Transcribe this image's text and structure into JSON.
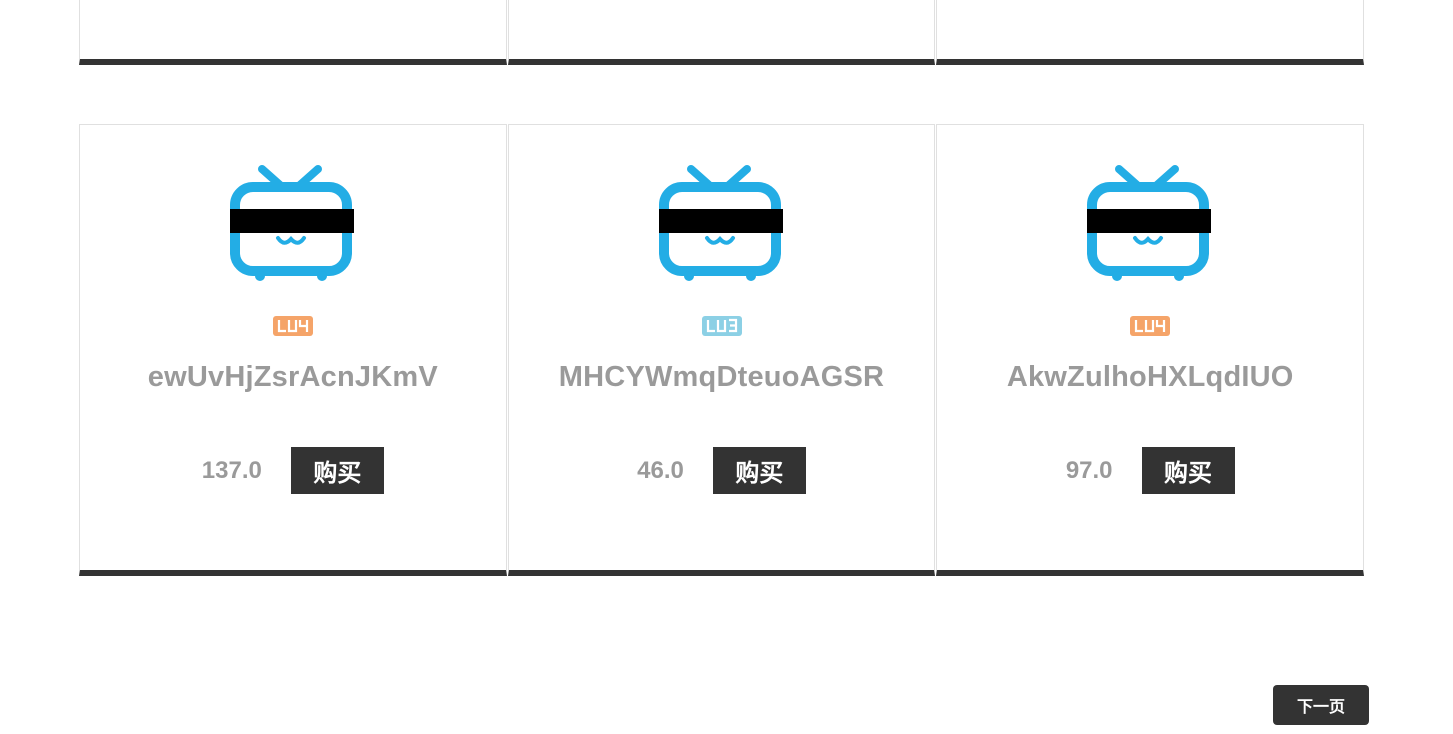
{
  "colors": {
    "accent_blue": "#23ADE5",
    "lv4_orange": "#F5A469",
    "lv3_blue": "#8CD0E5",
    "dark": "#333333",
    "text_gray": "#9A9A9A",
    "border": "#E0E0E0"
  },
  "cards": [
    {
      "avatar_icon": "bilibili-tv-icon",
      "level": "LV4",
      "level_color": "#F5A469",
      "username": "ewUvHjZsrAcnJKmV",
      "price": "137.0",
      "buy_label": "购买"
    },
    {
      "avatar_icon": "bilibili-tv-icon",
      "level": "LV3",
      "level_color": "#8CD0E5",
      "username": "MHCYWmqDteuoAGSR",
      "price": "46.0",
      "buy_label": "购买"
    },
    {
      "avatar_icon": "bilibili-tv-icon",
      "level": "LV4",
      "level_color": "#F5A469",
      "username": "AkwZulhoHXLqdIUO",
      "price": "97.0",
      "buy_label": "购买"
    }
  ],
  "pagination": {
    "next_label": "下一页"
  }
}
